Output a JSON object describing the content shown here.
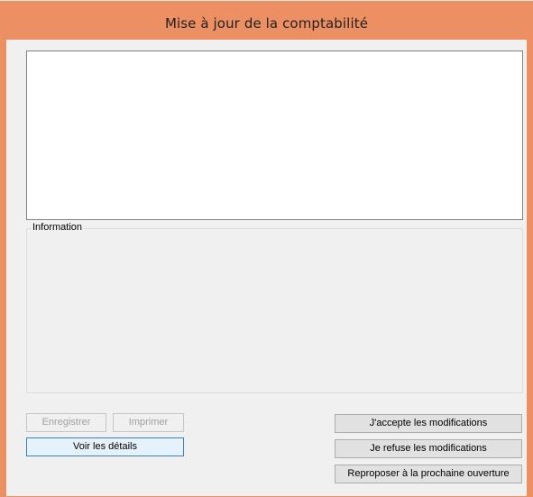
{
  "window": {
    "title": "Mise à jour de la comptabilité",
    "accent_color": "#ec8f63"
  },
  "details_text": {
    "value": ""
  },
  "information": {
    "legend": "Information",
    "content": ""
  },
  "buttons": {
    "save": {
      "label": "Enregistrer",
      "enabled": false
    },
    "print": {
      "label": "Imprimer",
      "enabled": false
    },
    "details": {
      "label": "Voir les détails",
      "enabled": true
    },
    "accept": {
      "label": "J'accepte les modifications",
      "enabled": true
    },
    "refuse": {
      "label": "Je refuse les modifications",
      "enabled": true
    },
    "postpone": {
      "label": "Reproposer à la prochaine ouverture",
      "enabled": true
    }
  }
}
